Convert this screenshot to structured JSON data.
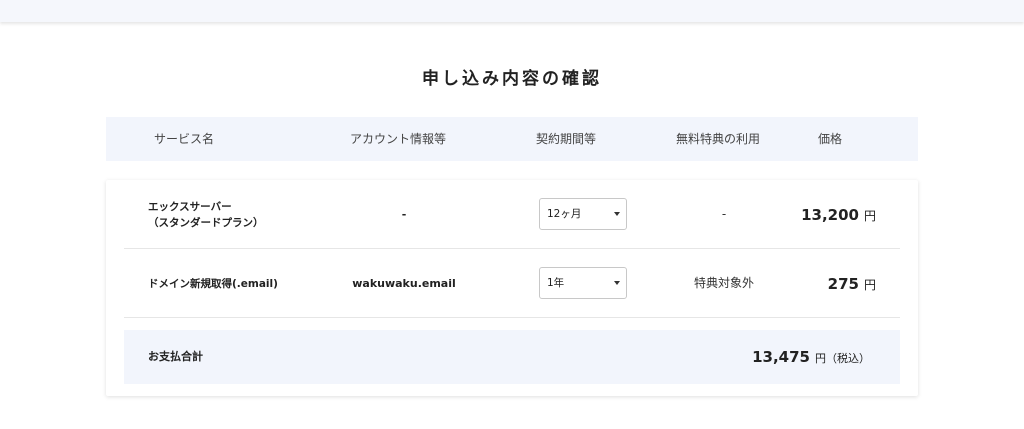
{
  "page": {
    "title": "申し込み内容の確認"
  },
  "table": {
    "headers": {
      "service": "サービス名",
      "account": "アカウント情報等",
      "period": "契約期間等",
      "benefit": "無料特典の利用",
      "price": "価格"
    },
    "rows": [
      {
        "service_line1": "エックスサーバー",
        "service_line2": "（スタンダードプラン）",
        "account": "-",
        "period": "12ヶ月",
        "benefit": "-",
        "price": "13,200",
        "unit": "円"
      },
      {
        "service_line1": "ドメイン新規取得(.email)",
        "account": "wakuwaku.email",
        "period": "1年",
        "benefit": "特典対象外",
        "price": "275",
        "unit": "円"
      }
    ],
    "total": {
      "label": "お支払合計",
      "price": "13,475",
      "unit": "円（税込）"
    }
  },
  "colors": {
    "header_bg": "#f2f5fc",
    "accent_text": "#222222"
  }
}
